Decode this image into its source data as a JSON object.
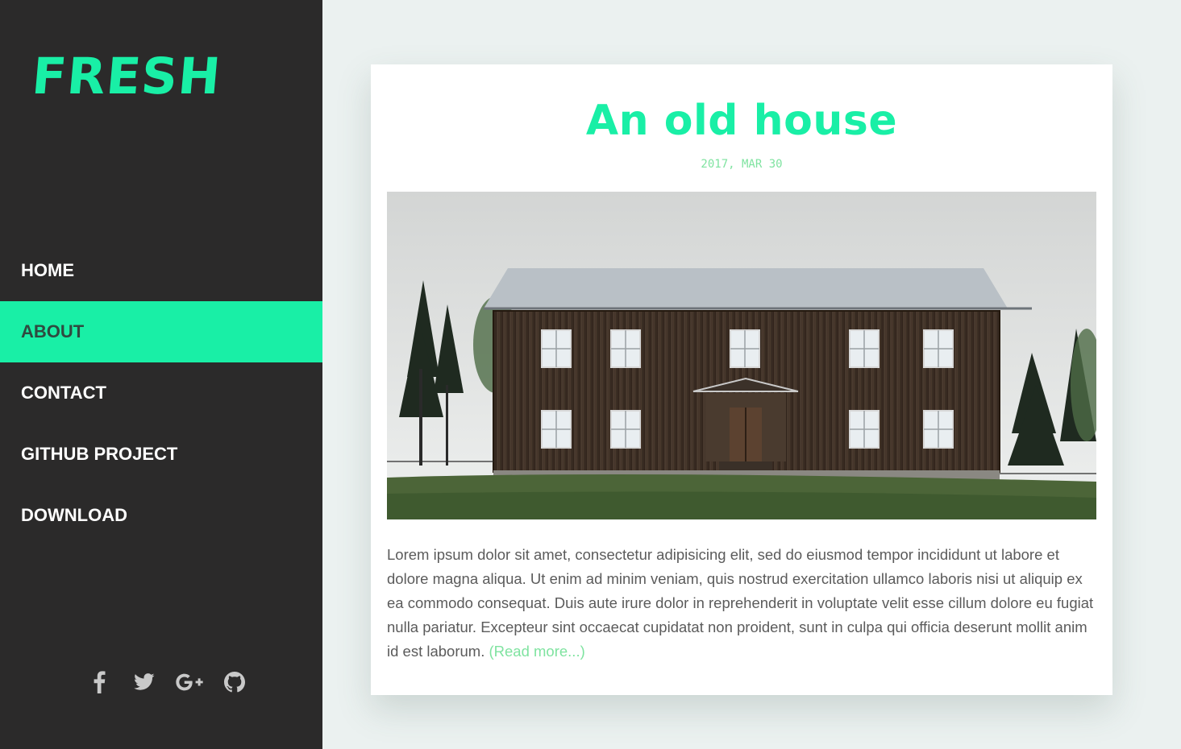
{
  "brand": {
    "logo_text": "FRESH",
    "accent_color": "#19efa6"
  },
  "nav": {
    "items": [
      {
        "label": "HOME",
        "active": false
      },
      {
        "label": "ABOUT",
        "active": true
      },
      {
        "label": "CONTACT",
        "active": false
      },
      {
        "label": "GITHUB PROJECT",
        "active": false
      },
      {
        "label": "DOWNLOAD",
        "active": false
      }
    ]
  },
  "social": {
    "icons": [
      "facebook-icon",
      "twitter-icon",
      "google-plus-icon",
      "github-icon"
    ]
  },
  "post": {
    "title": "An old house",
    "date": "2017, MAR 30",
    "image_subject": "wooden-house-photo",
    "excerpt": "Lorem ipsum dolor sit amet, consectetur adipisicing elit, sed do eiusmod tempor incididunt ut labore et dolore magna aliqua. Ut enim ad minim veniam, quis nostrud exercitation ullamco laboris nisi ut aliquip ex ea commodo consequat. Duis aute irure dolor in reprehenderit in voluptate velit esse cillum dolore eu fugiat nulla pariatur. Excepteur sint occaecat cupidatat non proident, sunt in culpa qui officia deserunt mollit anim id est laborum.",
    "read_more": "(Read more...)"
  }
}
